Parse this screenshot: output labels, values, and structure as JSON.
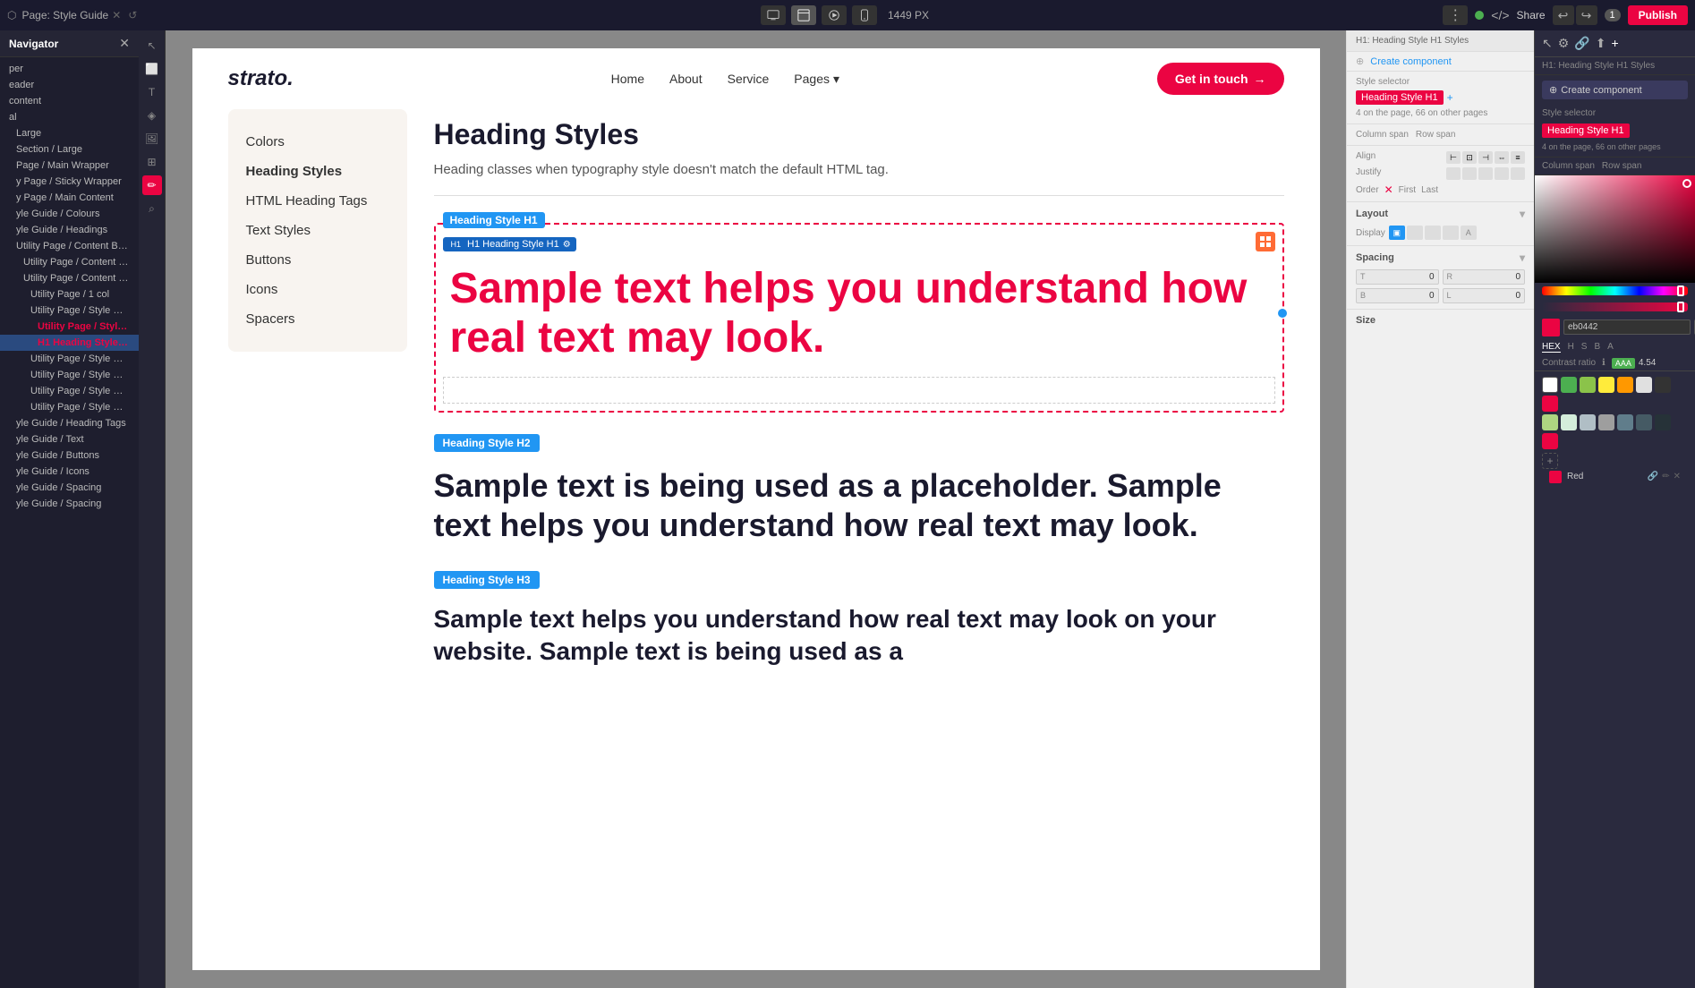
{
  "topbar": {
    "tab_label": "Page: Style Guide",
    "resolution": "1449 PX",
    "publish_label": "Publish",
    "share_label": "Share",
    "badge_num": "1",
    "undo": "↩",
    "redo": "↪"
  },
  "navigator": {
    "title": "Navigator",
    "items": [
      {
        "label": "per",
        "indent": 0
      },
      {
        "label": "eader",
        "indent": 0
      },
      {
        "label": "content",
        "indent": 0
      },
      {
        "label": "al",
        "indent": 0
      },
      {
        "label": "Large",
        "indent": 1
      },
      {
        "label": "Section / Large",
        "indent": 1
      },
      {
        "label": "Page / Main Wrapper",
        "indent": 1
      },
      {
        "label": "y Page / Sticky Wrapper",
        "indent": 1
      },
      {
        "label": "y Page / Main Content",
        "indent": 1
      },
      {
        "label": "yle Guide / Colours",
        "indent": 1
      },
      {
        "label": "yle Guide / Headings",
        "indent": 1
      },
      {
        "label": "Utility Page / Content Block",
        "indent": 1
      },
      {
        "label": "Utility Page / Content Header",
        "indent": 2
      },
      {
        "label": "Utility Page / Content Main",
        "indent": 2
      },
      {
        "label": "Utility Page / 1 col",
        "indent": 3
      },
      {
        "label": "Utility Page / Style Guide",
        "indent": 3
      },
      {
        "label": "Utility Page / Style Gui...",
        "indent": 4
      },
      {
        "label": "H1 Heading Style H1",
        "indent": 4,
        "selected": true
      },
      {
        "label": "Utility Page / Style Guide",
        "indent": 3
      },
      {
        "label": "Utility Page / Style Guide",
        "indent": 3
      },
      {
        "label": "Utility Page / Style Guide",
        "indent": 3
      },
      {
        "label": "Utility Page / Style Guide",
        "indent": 3
      },
      {
        "label": "yle Guide / Heading Tags",
        "indent": 1
      },
      {
        "label": "yle Guide / Text",
        "indent": 1
      },
      {
        "label": "yle Guide / Buttons",
        "indent": 1
      },
      {
        "label": "yle Guide / Icons",
        "indent": 1
      },
      {
        "label": "yle Guide / Spacing",
        "indent": 1
      },
      {
        "label": "yle Guide / Spacing",
        "indent": 1
      }
    ]
  },
  "site": {
    "logo": "strato.",
    "nav": {
      "home": "Home",
      "about": "About",
      "service": "Service",
      "pages": "Pages",
      "cta": "Get in touch"
    },
    "sidebar_menu": [
      {
        "label": "Colors"
      },
      {
        "label": "Heading Styles",
        "active": true
      },
      {
        "label": "HTML Heading Tags"
      },
      {
        "label": "Text Styles"
      },
      {
        "label": "Buttons"
      },
      {
        "label": "Icons"
      },
      {
        "label": "Spacers"
      }
    ],
    "main": {
      "title": "Heading Styles",
      "description": "Heading classes when typography style doesn't match the default HTML tag.",
      "h1_label": "Heading Style H1",
      "h1_inner_label": "H1 Heading Style H1",
      "h1_text": "Sample text helps you understand how real text may look.",
      "h2_label": "Heading Style H2",
      "h2_text": "Sample text is being used as a placeholder. Sample text helps you understand how real text may look.",
      "h3_label": "Heading Style H3",
      "h3_text": "Sample text helps you understand how real text may look on your website. Sample text is being used as a"
    }
  },
  "right_panel": {
    "breadcrumb": "H1: Heading Style H1 Styles",
    "create_component": "Create component",
    "style_selector_label": "Style selector",
    "style_value": "Heading Style H1",
    "note": "4 on the page, 66 on other pages",
    "column_span_label": "Column span",
    "row_span_label": "Row span",
    "align_label": "Align",
    "justify_label": "Justify",
    "order_label": "Order",
    "first_label": "First",
    "last_label": "Last",
    "layout_section": "Layout",
    "display_label": "Display",
    "spacing_section": "Spacing",
    "size_section": "Size"
  },
  "color_picker": {
    "hex": "#eb0442",
    "hex_display": "eb0442",
    "h": "344",
    "s": "98",
    "b": "92",
    "a": "100",
    "tab_hex": "HEX",
    "tab_h": "H",
    "tab_s": "S",
    "tab_b": "B",
    "tab_a": "A",
    "contrast_label": "Contrast ratio",
    "contrast_badge": "AAA",
    "contrast_val": "4.54",
    "named_color": "Red",
    "swatches": [
      "#fff",
      "#4caf50",
      "#8bc34a",
      "#ffeb3b",
      "#ff9800",
      "#e0e0e0",
      "#333",
      "#eb0442",
      "#aed581",
      "#d4edda",
      "#b0bec5",
      "#9e9e9e",
      "#607d8b",
      "#455a64",
      "#263238",
      "#eb0442"
    ]
  }
}
